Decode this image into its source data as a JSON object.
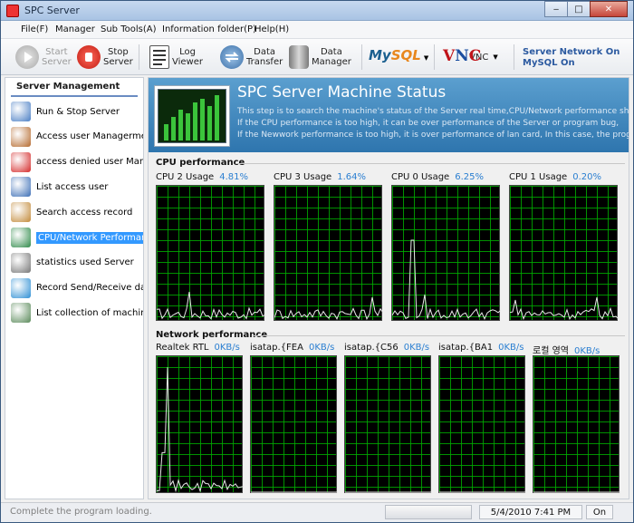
{
  "window": {
    "title": "SPC Server"
  },
  "menu": [
    "File(F)",
    "Manager",
    "Sub Tools(A)",
    "Information folder(P)",
    "Help(H)"
  ],
  "toolbar": {
    "start": "Start\nServer",
    "stop": "Stop\nServer",
    "log": "Log\nViewer",
    "transfer": "Data\nTransfer",
    "dm": "Data\nManager",
    "vnc": "VNC",
    "status1": "Server Network On",
    "status2": "MySQL On"
  },
  "sidebar": {
    "title": "Server Management",
    "items": [
      {
        "label": "Run & Stop Server",
        "icon": "monitor-run-icon",
        "color": "#4a7ec4"
      },
      {
        "label": "Access user Managerment",
        "icon": "users-icon",
        "color": "#b56a2e"
      },
      {
        "label": "access denied user Managem",
        "icon": "no-entry-icon",
        "color": "#d42a2a"
      },
      {
        "label": "List access user",
        "icon": "user-list-icon",
        "color": "#3d6fb6"
      },
      {
        "label": "Search access record",
        "icon": "search-record-icon",
        "color": "#c28a3a"
      },
      {
        "label": "CPU/Network Performance",
        "icon": "performance-chart-icon",
        "color": "#2f8a4a",
        "selected": true
      },
      {
        "label": "statistics used Server",
        "icon": "statistics-icon",
        "color": "#777777"
      },
      {
        "label": "Record Send/Receive data",
        "icon": "globe-icon",
        "color": "#2e8fd4"
      },
      {
        "label": "List collection of machine da",
        "icon": "collection-icon",
        "color": "#5a8a5a"
      }
    ]
  },
  "banner": {
    "title": "SPC Server Machine Status",
    "line1": "This step is to search the machine's status of the Server real time,CPU/Network performance shoul",
    "line2": "If the CPU performance is too high, it can be over performance of the Server or program bug,",
    "line3": "If the Newwork performance is too high, it is over performance of lan card, In this case, the program"
  },
  "cpu": {
    "title": "CPU performance",
    "graphs": [
      {
        "label": "CPU 2 Usage",
        "value": "4.81%"
      },
      {
        "label": "CPU 3 Usage",
        "value": "1.64%"
      },
      {
        "label": "CPU 0 Usage",
        "value": "6.25%"
      },
      {
        "label": "CPU 1 Usage",
        "value": "0.20%"
      }
    ]
  },
  "network": {
    "title": "Network performance",
    "graphs": [
      {
        "label": "Realtek RTL",
        "value": "0KB/s"
      },
      {
        "label": "isatap.{FEA",
        "value": "0KB/s"
      },
      {
        "label": "isatap.{C56",
        "value": "0KB/s"
      },
      {
        "label": "isatap.{BA1",
        "value": "0KB/s"
      },
      {
        "label": "로컬 영역",
        "value": "0KB/s"
      }
    ]
  },
  "status": {
    "message": "Complete the program loading.",
    "datetime": "5/4/2010  7:41 PM",
    "state": "On"
  }
}
